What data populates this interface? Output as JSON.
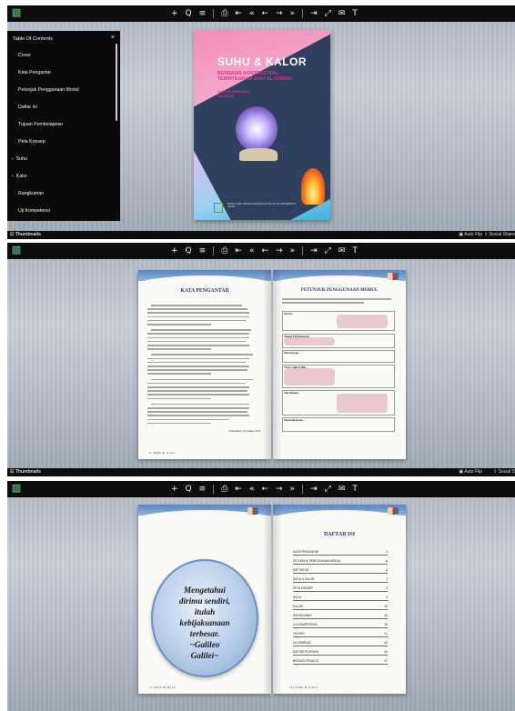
{
  "toolbar": {
    "icons": [
      "zoom-in",
      "search",
      "table-of-contents",
      "print",
      "first-page",
      "previous-page",
      "back",
      "forward",
      "next-page",
      "last-page",
      "fullscreen",
      "email",
      "text-mode"
    ],
    "glyphs": [
      "+",
      "Q",
      "≡",
      "⎙",
      "⇤",
      "«",
      "←",
      "→",
      "»",
      "⇥",
      "⤢",
      "✉",
      "T"
    ]
  },
  "bottombar": {
    "thumbnails": "Thumbnails",
    "autoflip": "Auto Flip",
    "social": "Social Share",
    "social_short": "Social S"
  },
  "toc": {
    "title": "Table Of Contents",
    "close": "×",
    "items": [
      {
        "label": "Cover",
        "expand": ""
      },
      {
        "label": "Kata Pengantar",
        "expand": ""
      },
      {
        "label": "Petunjuk Penggunaan Modul",
        "expand": ""
      },
      {
        "label": "Daftar Isi",
        "expand": ""
      },
      {
        "label": "Tujuan Pembelajaran",
        "expand": ""
      },
      {
        "label": "Peta Konsep",
        "expand": ""
      },
      {
        "label": "Suhu",
        "expand": "›"
      },
      {
        "label": "Kalor",
        "expand": "›"
      },
      {
        "label": "Rangkuman",
        "expand": ""
      },
      {
        "label": "Uji Kompetensi",
        "expand": ""
      }
    ]
  },
  "cover": {
    "title": "SUHU & KALOR",
    "subtitle": "BERBASIS KONTEKSTUAL TERINTEGRASI AYAT AL-QURAN",
    "grade_line1": "DAFTAR KIMIA BIDA",
    "grade_line2": "KELAS VII",
    "publisher": "MODUL ILMU PENGETAHUAN ALAM KELAS VII UNIVERSITAS ISLAM"
  },
  "spread2": {
    "left_heading": "KATA PENGANTAR",
    "signature": "Tembilahan,   November 2023",
    "footer": "Suhu & Kalor",
    "right_heading": "PETUNJUK PENGGUNAAN MODUL",
    "right_intro": "Untuk memudahkan kalian belajar, yuk pahami beberapa fitur yang ada di dalam modul elektronik ini :",
    "features": [
      "Quran :",
      "Tujuan Pembelajaran",
      "Peta Konsep :",
      "YUK CARI TAHU...",
      "Yuk Diskusi...",
      "Tahu kah kamu..."
    ]
  },
  "spread3": {
    "quote": [
      "Mengetahui",
      "dirimu sendiri,",
      "itulah",
      "kebijaksanaan",
      "terbesar.",
      "~Galileo",
      "Galilei~"
    ],
    "footer": "Suhu & Kalor",
    "toc_heading": "DAFTAR ISI",
    "toc_rows": [
      {
        "label": "KATA PENGANTAR",
        "page": "ii"
      },
      {
        "label": "PETUNJUK PENGGUNAAN MODUL",
        "page": "iii"
      },
      {
        "label": "DAFTAR ISI",
        "page": "vi"
      },
      {
        "label": "SUHU & KALOR",
        "page": "1"
      },
      {
        "label": "PETA KONSEP",
        "page": "2"
      },
      {
        "label": "SUHU",
        "page": "3"
      },
      {
        "label": "KALOR",
        "page": "19"
      },
      {
        "label": "RANGKUMAN",
        "page": "33"
      },
      {
        "label": "UJI KOMPETENSI",
        "page": "35"
      },
      {
        "label": "TEKSBY",
        "page": "41"
      },
      {
        "label": "GLOSARIUM",
        "page": "43"
      },
      {
        "label": "DAFTAR PUSTAKA",
        "page": "45"
      },
      {
        "label": "BIODATA PENULIS",
        "page": "47"
      }
    ]
  }
}
